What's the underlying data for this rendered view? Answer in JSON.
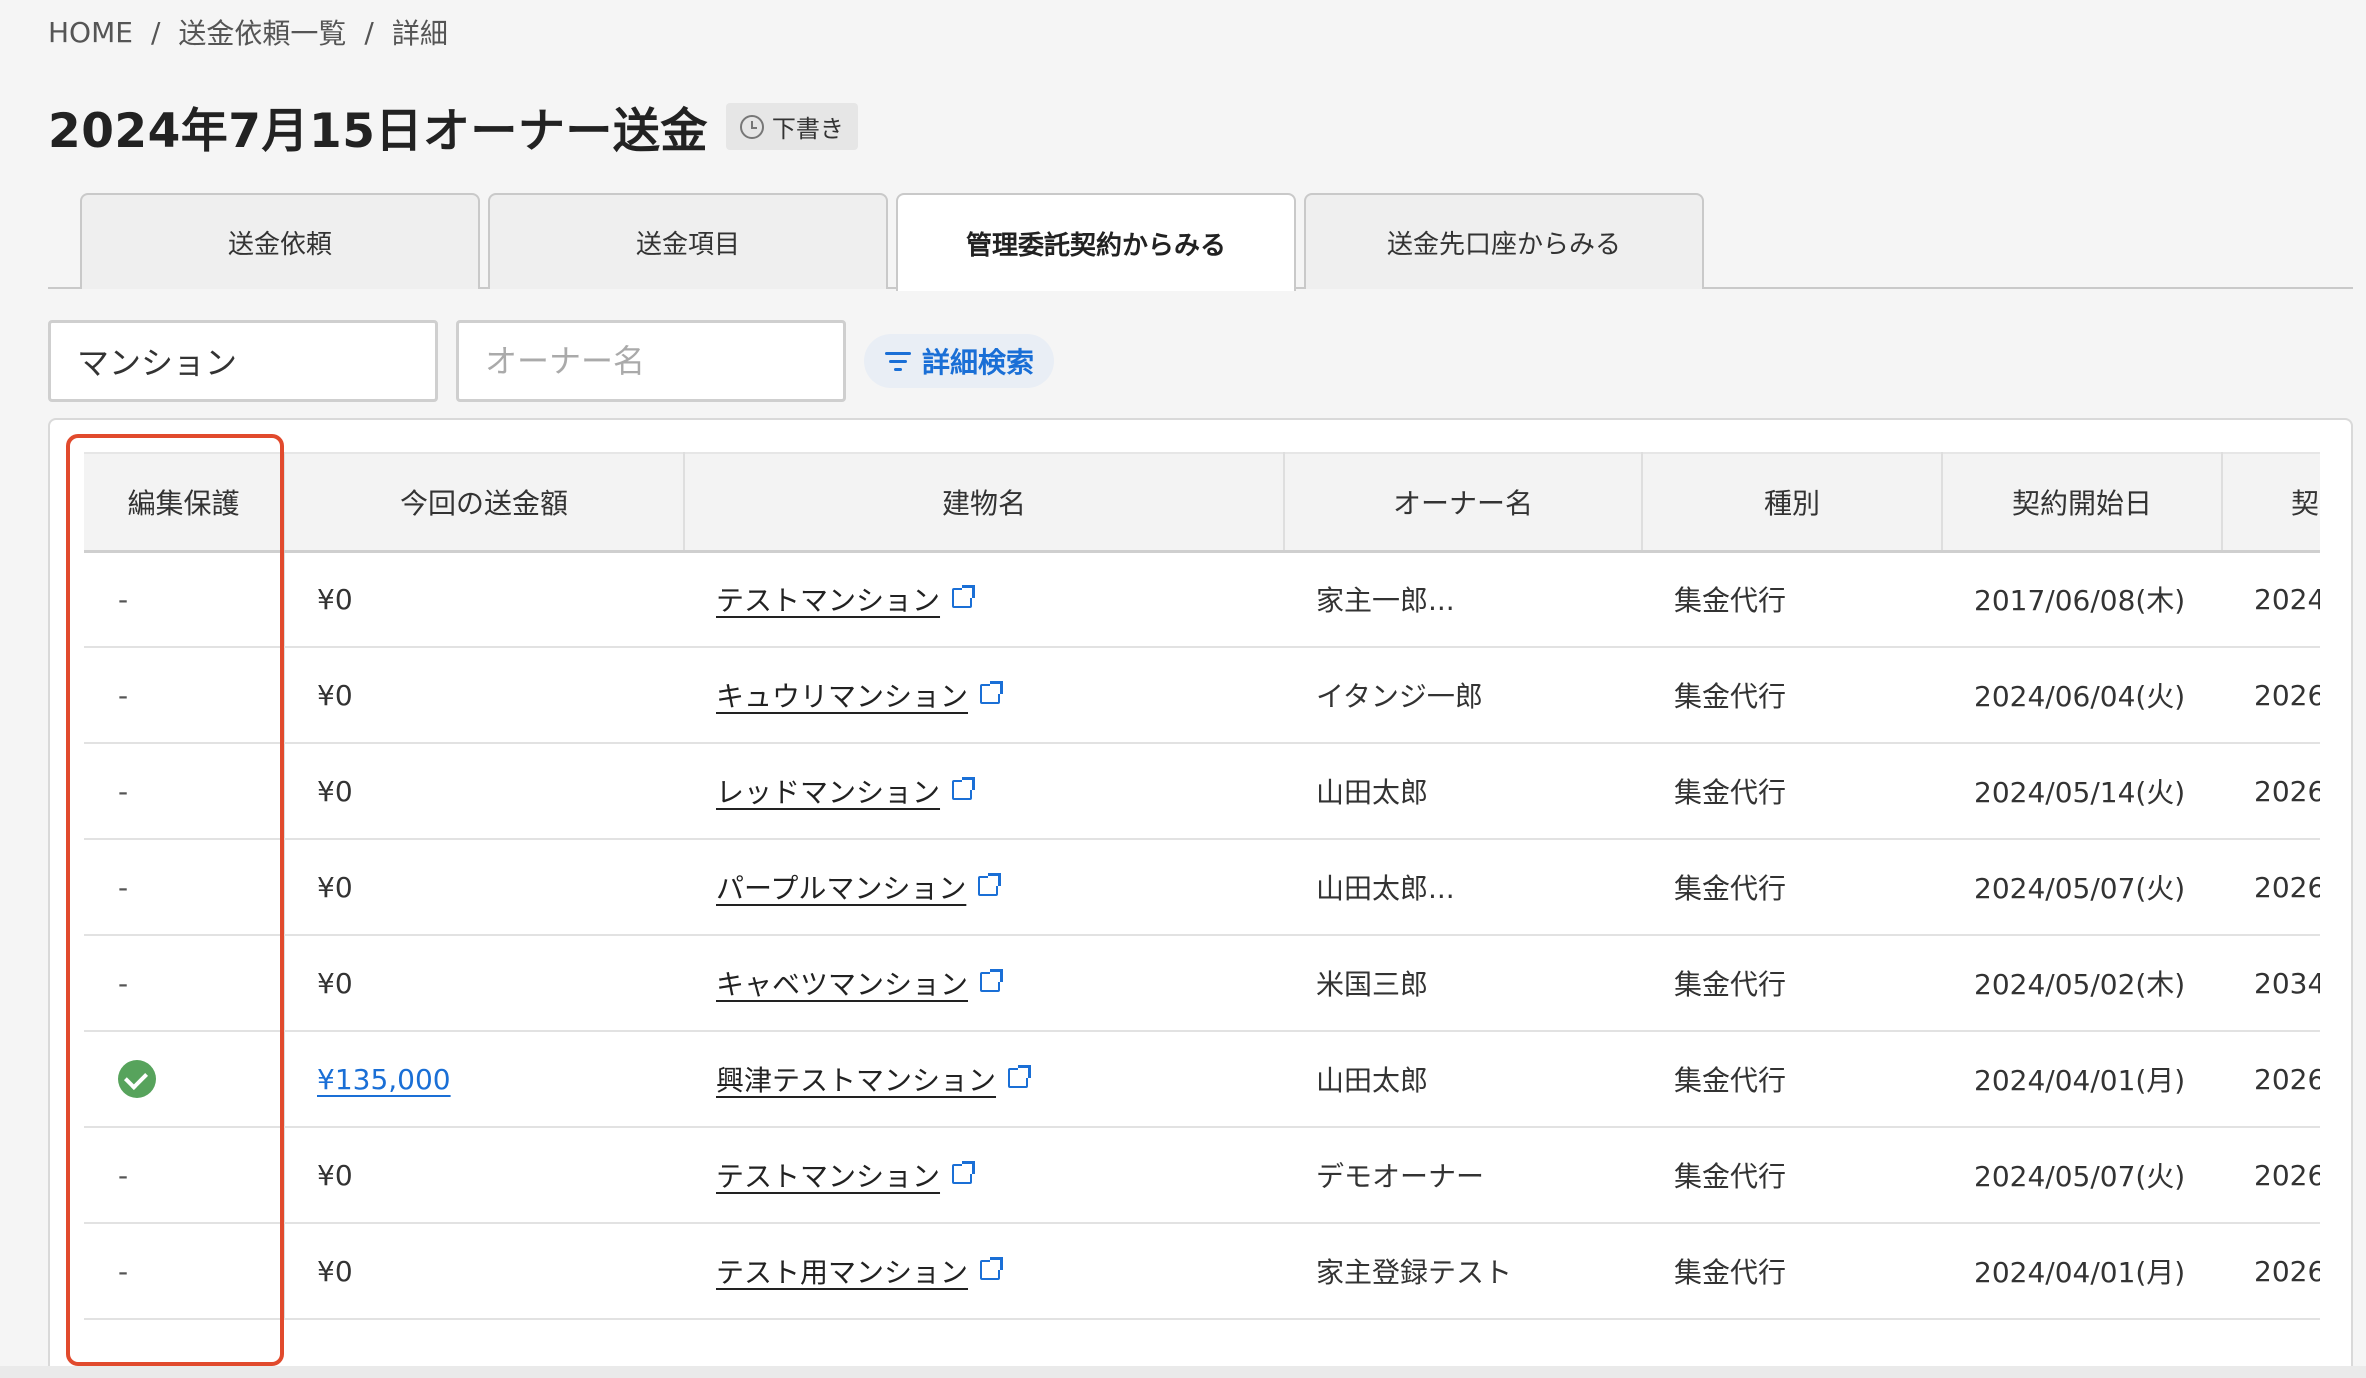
{
  "breadcrumb": [
    "HOME",
    "送金依頼一覧",
    "詳細"
  ],
  "page": {
    "title": "2024年7月15日オーナー送金",
    "status_badge": "下書き"
  },
  "tabs": [
    "送金依頼",
    "送金項目",
    "管理委託契約からみる",
    "送金先口座からみる"
  ],
  "active_tab": "管理委託契約からみる",
  "filters": {
    "building_value": "マンション",
    "owner_placeholder": "オーナー名",
    "advanced_search_label": "詳細検索"
  },
  "table": {
    "columns": [
      "編集保護",
      "今回の送金額",
      "建物名",
      "オーナー名",
      "種別",
      "契約開始日",
      "契"
    ],
    "rows": [
      {
        "protect": "-",
        "amount": "¥0",
        "building": "テストマンション",
        "owner": "家主一郎...",
        "type": "集金代行",
        "start": "2017/06/08(木)",
        "end": "2024"
      },
      {
        "protect": "-",
        "amount": "¥0",
        "building": "キュウリマンション",
        "owner": "イタンジ一郎",
        "type": "集金代行",
        "start": "2024/06/04(火)",
        "end": "2026"
      },
      {
        "protect": "-",
        "amount": "¥0",
        "building": "レッドマンション",
        "owner": "山田太郎",
        "type": "集金代行",
        "start": "2024/05/14(火)",
        "end": "2026"
      },
      {
        "protect": "-",
        "amount": "¥0",
        "building": "パープルマンション",
        "owner": "山田太郎...",
        "type": "集金代行",
        "start": "2024/05/07(火)",
        "end": "2026"
      },
      {
        "protect": "-",
        "amount": "¥0",
        "building": "キャベツマンション",
        "owner": "米国三郎",
        "type": "集金代行",
        "start": "2024/05/02(木)",
        "end": "2034"
      },
      {
        "protect": "check",
        "amount": "¥135,000",
        "building": "興津テストマンション",
        "owner": "山田太郎",
        "type": "集金代行",
        "start": "2024/04/01(月)",
        "end": "2026"
      },
      {
        "protect": "-",
        "amount": "¥0",
        "building": "テストマンション",
        "owner": "デモオーナー",
        "type": "集金代行",
        "start": "2024/05/07(火)",
        "end": "2026"
      },
      {
        "protect": "-",
        "amount": "¥0",
        "building": "テスト用マンション",
        "owner": "家主登録テスト",
        "type": "集金代行",
        "start": "2024/04/01(月)",
        "end": "2026"
      }
    ]
  },
  "accent_color": "#1a6fd6",
  "highlight_color": "#e14a2d"
}
